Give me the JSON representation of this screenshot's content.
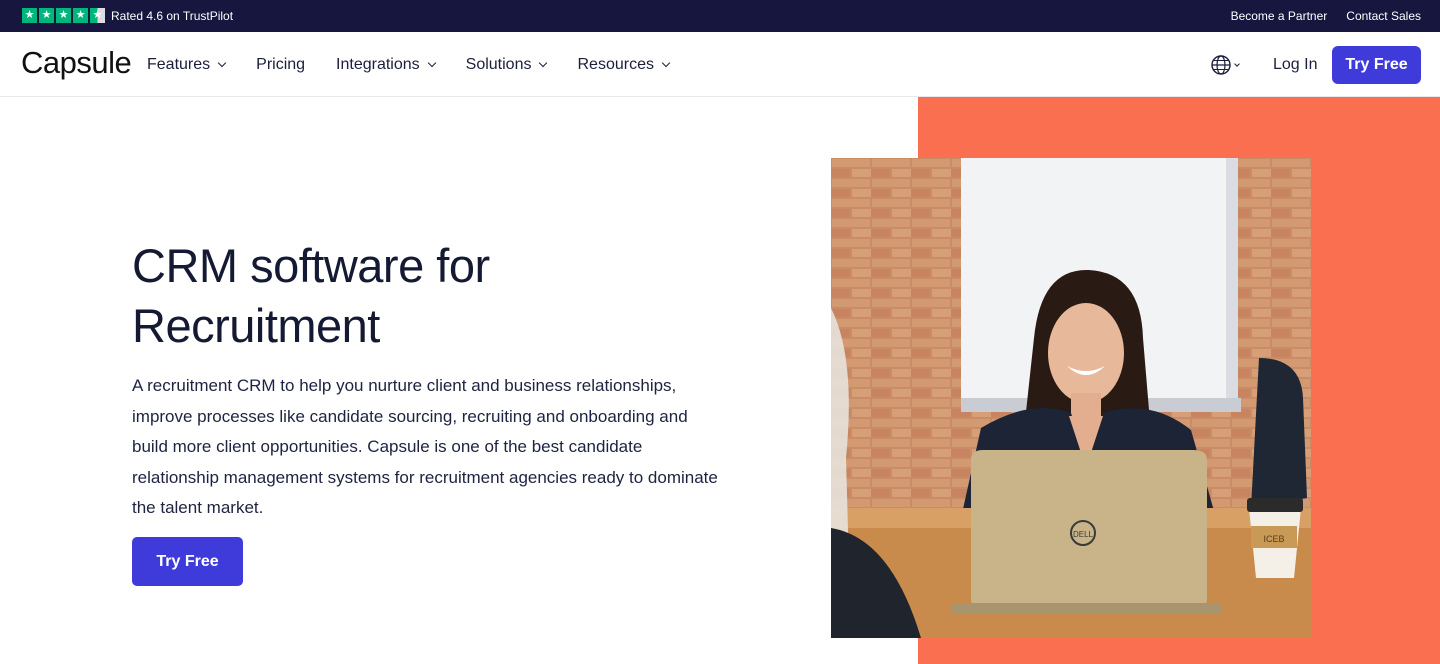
{
  "topbar": {
    "stars": [
      "★",
      "★",
      "★",
      "★",
      "★"
    ],
    "rating_text": "Rated 4.6 on TrustPilot",
    "links": [
      "Become a Partner",
      "Contact Sales"
    ]
  },
  "nav": {
    "logo": "Capsule",
    "menu": [
      {
        "label": "Features",
        "dropdown": true
      },
      {
        "label": "Pricing",
        "dropdown": false
      },
      {
        "label": "Integrations",
        "dropdown": true
      },
      {
        "label": "Solutions",
        "dropdown": true
      },
      {
        "label": "Resources",
        "dropdown": true
      }
    ],
    "globe_icon": "globe-icon",
    "login": "Log In",
    "cta": "Try Free"
  },
  "hero": {
    "title_line1": "CRM software for",
    "title_line2": "Recruitment",
    "description": "A recruitment CRM to help you nurture client and business relationships, improve processes like candidate sourcing, recruiting and onboarding and build more client opportunities. Capsule is one of the best candidate relationship management systems for recruitment agencies ready to dominate the talent market.",
    "cta": "Try Free",
    "image_laptop_brand": "DELL",
    "image_cup_text": "ICEB"
  },
  "colors": {
    "topbar_bg": "#16163f",
    "brand_button": "#3f3bdb",
    "accent_coral": "#f96f50",
    "trustpilot_green": "#00b67a"
  }
}
